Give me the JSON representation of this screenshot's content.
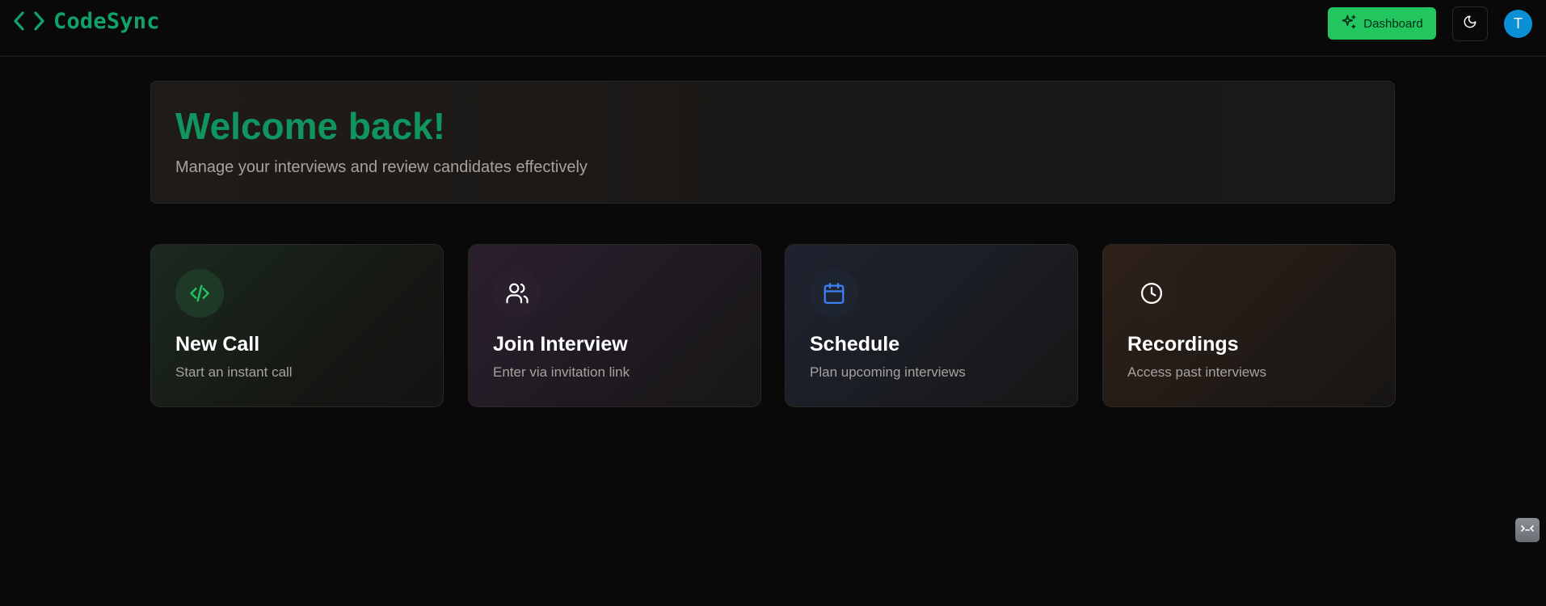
{
  "header": {
    "brand_name": "CodeSync",
    "brand_icon": "code-brackets-icon",
    "dashboard_label": "Dashboard",
    "dashboard_icon": "sparkles-icon",
    "theme_icon": "moon-icon",
    "avatar_initial": "T"
  },
  "welcome": {
    "title": "Welcome back!",
    "subtitle": "Manage your interviews and review candidates effectively"
  },
  "actions": [
    {
      "title": "New Call",
      "subtitle": "Start an instant call",
      "icon": "code-icon",
      "accent": "#22c55e"
    },
    {
      "title": "Join Interview",
      "subtitle": "Enter via invitation link",
      "icon": "users-icon",
      "accent": "#ffffff"
    },
    {
      "title": "Schedule",
      "subtitle": "Plan upcoming interviews",
      "icon": "calendar-icon",
      "accent": "#3b82f6"
    },
    {
      "title": "Recordings",
      "subtitle": "Access past interviews",
      "icon": "clock-icon",
      "accent": "#ffffff"
    }
  ],
  "colors": {
    "background": "#0a0909",
    "brand": "#11a26a",
    "primary_button": "#22c55e",
    "avatar": "#0b8fd6"
  }
}
